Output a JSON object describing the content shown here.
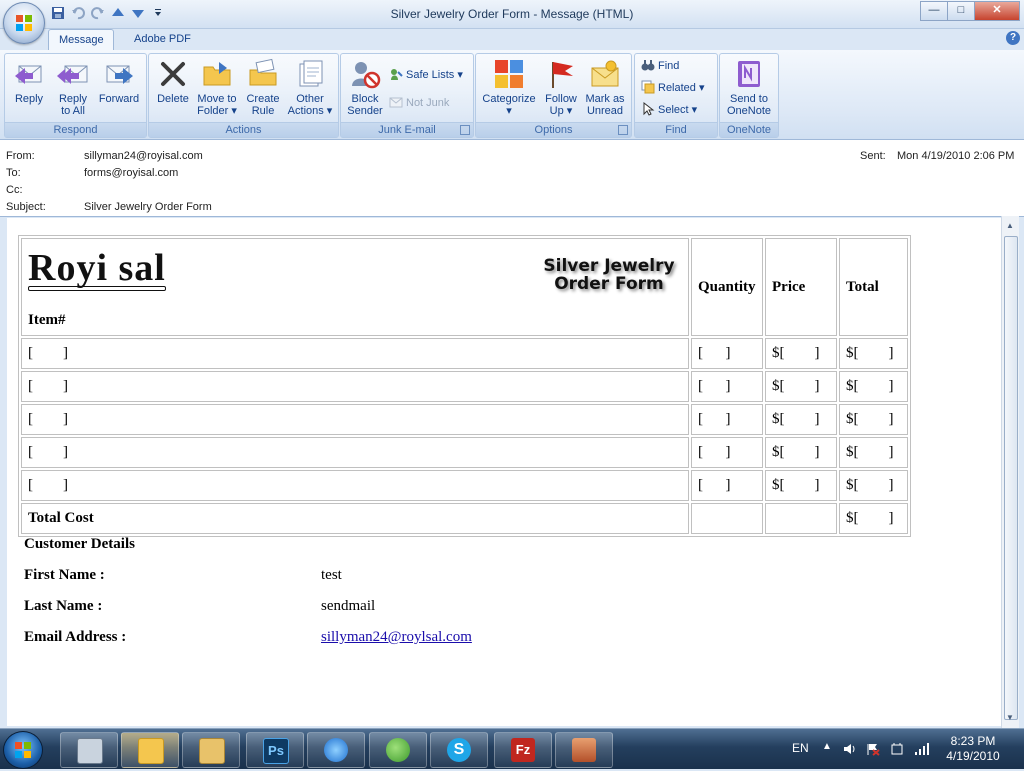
{
  "window": {
    "title": "Silver Jewelry Order Form - Message (HTML)",
    "controls": [
      "—",
      "□",
      "✕"
    ]
  },
  "tabs": [
    {
      "label": "Message",
      "active": true
    },
    {
      "label": "Adobe PDF",
      "active": false
    }
  ],
  "ribbon": {
    "respond": {
      "label": "Respond",
      "buttons": [
        {
          "line1": "Reply",
          "line2": ""
        },
        {
          "line1": "Reply",
          "line2": "to All"
        },
        {
          "line1": "Forward",
          "line2": ""
        }
      ]
    },
    "actions": {
      "label": "Actions",
      "buttons": [
        {
          "line1": "Delete",
          "line2": ""
        },
        {
          "line1": "Move to",
          "line2": "Folder ▾"
        },
        {
          "line1": "Create",
          "line2": "Rule"
        },
        {
          "line1": "Other",
          "line2": "Actions ▾"
        }
      ]
    },
    "junk": {
      "label": "Junk E-mail",
      "block_line1": "Block",
      "block_line2": "Sender",
      "safe_lists": "Safe Lists ▾",
      "not_junk": "Not Junk"
    },
    "options": {
      "label": "Options",
      "buttons": [
        {
          "line1": "Categorize",
          "line2": "▾"
        },
        {
          "line1": "Follow",
          "line2": "Up ▾"
        },
        {
          "line1": "Mark as",
          "line2": "Unread"
        }
      ]
    },
    "find": {
      "label": "Find",
      "find": "Find",
      "related": "Related ▾",
      "select": "Select ▾"
    },
    "onenote": {
      "label": "OneNote",
      "line1": "Send to",
      "line2": "OneNote"
    }
  },
  "header": {
    "from_label": "From:",
    "from_value": "sillyman24@royisal.com",
    "to_label": "To:",
    "to_value": "forms@royisal.com",
    "cc_label": "Cc:",
    "cc_value": "",
    "subject_label": "Subject:",
    "subject_value": "Silver Jewelry Order Form",
    "sent_label": "Sent:",
    "sent_value": "Mon 4/19/2010 2:06 PM"
  },
  "form": {
    "brand": "Royi sal",
    "title_line1": "Silver Jewelry",
    "title_line2": "Order Form",
    "item_header": "Item#",
    "quantity_header": "Quantity",
    "price_header": "Price",
    "total_header": "Total",
    "rows": [
      {
        "item": "[        ]",
        "qty": "[      ]",
        "price": "$[        ]",
        "total": "$[        ]"
      },
      {
        "item": "[        ]",
        "qty": "[      ]",
        "price": "$[        ]",
        "total": "$[        ]"
      },
      {
        "item": "[        ]",
        "qty": "[      ]",
        "price": "$[        ]",
        "total": "$[        ]"
      },
      {
        "item": "[        ]",
        "qty": "[      ]",
        "price": "$[        ]",
        "total": "$[        ]"
      },
      {
        "item": "[        ]",
        "qty": "[      ]",
        "price": "$[        ]",
        "total": "$[        ]"
      }
    ],
    "total_cost_label": "Total Cost",
    "total_cost_value": "$[        ]"
  },
  "customer": {
    "heading": "Customer Details",
    "first_name_label": "First Name :",
    "first_name_value": "test",
    "last_name_label": "Last Name :",
    "last_name_value": "sendmail",
    "email_label": "Email Address :",
    "email_value": "sillyman24@roylsal.com"
  },
  "taskbar": {
    "language": "EN",
    "time": "8:23 PM",
    "date": "4/19/2010",
    "apps": [
      "calculator-icon",
      "outlook-icon",
      "explorer-icon",
      "photoshop-icon",
      "ie-icon",
      "messenger-icon",
      "skype-icon",
      "filezilla-icon",
      "app-icon"
    ],
    "ps_label": "Ps",
    "fz_label": "Fz",
    "skype_label": "S"
  },
  "colors": {
    "accent": "#15428b",
    "ribbon_bg": "#dde8f6",
    "link": "#1a0dab",
    "taskbar": "#243f5e"
  }
}
